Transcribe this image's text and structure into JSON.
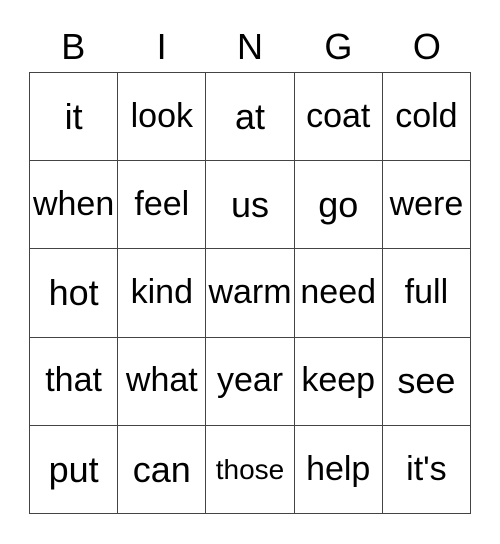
{
  "card": {
    "title": "BINGO",
    "headers": [
      "B",
      "I",
      "N",
      "G",
      "O"
    ],
    "rows": [
      [
        "it",
        "look",
        "at",
        "coat",
        "cold"
      ],
      [
        "when",
        "feel",
        "us",
        "go",
        "were"
      ],
      [
        "hot",
        "kind",
        "warm",
        "need",
        "full"
      ],
      [
        "that",
        "what",
        "year",
        "keep",
        "see"
      ],
      [
        "put",
        "can",
        "those",
        "help",
        "it's"
      ]
    ],
    "colors": {
      "border": "#444444",
      "text": "#000000",
      "background": "#ffffff"
    }
  }
}
